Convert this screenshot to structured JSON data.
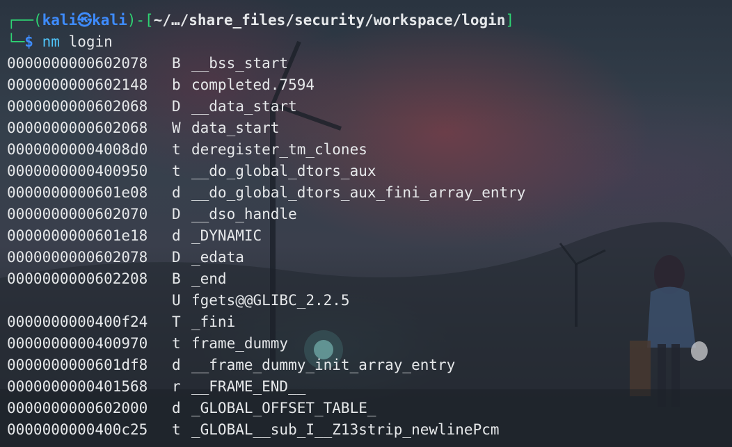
{
  "prompt": {
    "user": "kali",
    "host": "kali",
    "separator_icon": "kali-dragon-icon",
    "cwd": "~/…/share_files/security/workspace/login",
    "dollar": "$",
    "command": "nm",
    "argument": "login"
  },
  "symbols": [
    {
      "address": "0000000000602078",
      "type": "B",
      "name": "__bss_start"
    },
    {
      "address": "0000000000602148",
      "type": "b",
      "name": "completed.7594"
    },
    {
      "address": "0000000000602068",
      "type": "D",
      "name": "__data_start"
    },
    {
      "address": "0000000000602068",
      "type": "W",
      "name": "data_start"
    },
    {
      "address": "00000000004008d0",
      "type": "t",
      "name": "deregister_tm_clones"
    },
    {
      "address": "0000000000400950",
      "type": "t",
      "name": "__do_global_dtors_aux"
    },
    {
      "address": "0000000000601e08",
      "type": "d",
      "name": "__do_global_dtors_aux_fini_array_entry"
    },
    {
      "address": "0000000000602070",
      "type": "D",
      "name": "__dso_handle"
    },
    {
      "address": "0000000000601e18",
      "type": "d",
      "name": "_DYNAMIC"
    },
    {
      "address": "0000000000602078",
      "type": "D",
      "name": "_edata"
    },
    {
      "address": "0000000000602208",
      "type": "B",
      "name": "_end"
    },
    {
      "address": "",
      "type": "U",
      "name": "fgets@@GLIBC_2.2.5"
    },
    {
      "address": "0000000000400f24",
      "type": "T",
      "name": "_fini"
    },
    {
      "address": "0000000000400970",
      "type": "t",
      "name": "frame_dummy"
    },
    {
      "address": "0000000000601df8",
      "type": "d",
      "name": "__frame_dummy_init_array_entry"
    },
    {
      "address": "0000000000401568",
      "type": "r",
      "name": "__FRAME_END__"
    },
    {
      "address": "0000000000602000",
      "type": "d",
      "name": "_GLOBAL_OFFSET_TABLE_"
    },
    {
      "address": "0000000000400c25",
      "type": "t",
      "name": "_GLOBAL__sub_I__Z13strip_newlinePcm"
    }
  ],
  "colors": {
    "prompt_frame": "#2ed573",
    "prompt_user": "#3e8cff",
    "command": "#4fc3f7",
    "text": "#e6e8ea"
  }
}
